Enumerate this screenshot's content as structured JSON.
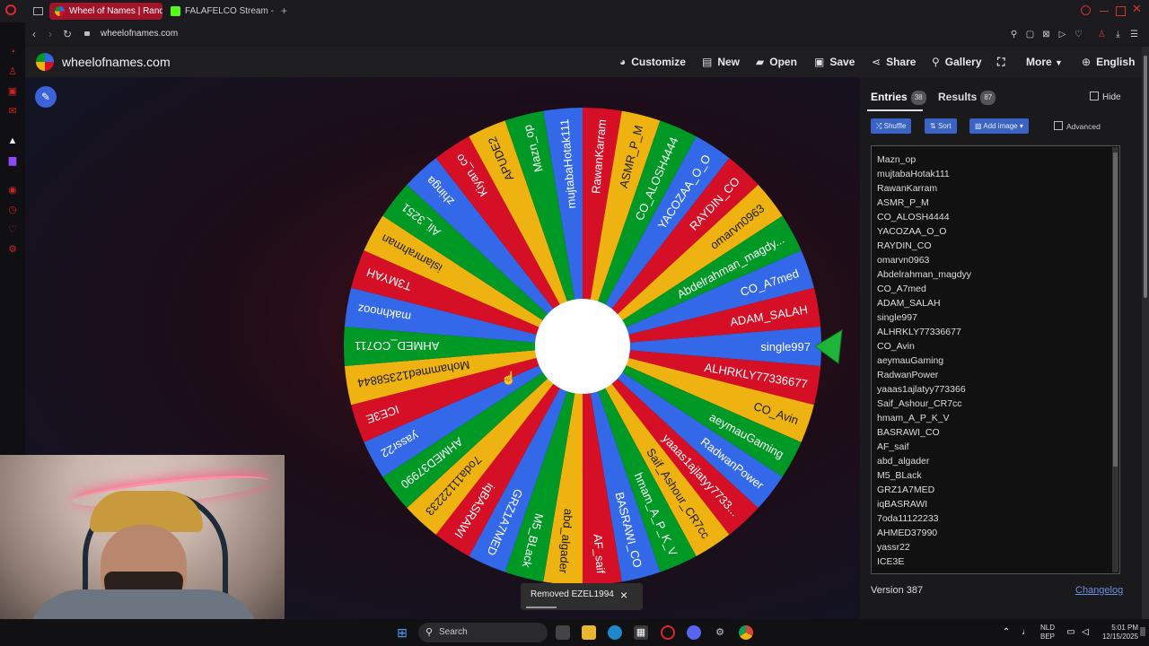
{
  "browser": {
    "tabs": [
      {
        "title": "Wheel of Names | Randon",
        "active": true,
        "color": "#c42b3a"
      },
      {
        "title": "FALAFELCO Stream - Wa",
        "active": false,
        "color": "#53fc18"
      }
    ],
    "new_tab_label": "+",
    "url": "wheelofnames.com"
  },
  "header": {
    "site_name": "wheelofnames.com",
    "menu": [
      {
        "label": "Customize",
        "icon": "palette-icon"
      },
      {
        "label": "New",
        "icon": "file-icon"
      },
      {
        "label": "Open",
        "icon": "folder-icon"
      },
      {
        "label": "Save",
        "icon": "save-icon"
      },
      {
        "label": "Share",
        "icon": "share-icon"
      },
      {
        "label": "Gallery",
        "icon": "search-icon"
      },
      {
        "label": "",
        "icon": "fullscreen-icon"
      },
      {
        "label": "More",
        "icon": "chevron-down-icon"
      },
      {
        "label": "English",
        "icon": "globe-icon"
      }
    ]
  },
  "panel": {
    "entries_tab": "Entries",
    "entries_count": "38",
    "results_tab": "Results",
    "results_count": "87",
    "hide_label": "Hide",
    "shuffle_label": "Shuffle",
    "sort_label": "Sort",
    "add_image_label": "Add image",
    "advanced_label": "Advanced",
    "version": "Version 387",
    "changelog": "Changelog"
  },
  "entries_visible": [
    "Mazn_op",
    "mujtabaHotak111",
    "RawanKarram",
    "ASMR_P_M",
    "CO_ALOSH4444",
    "YACOZAA_O_O",
    "RAYDIN_CO",
    "omarvn0963",
    "Abdelrahman_magdyy",
    "CO_A7med",
    "ADAM_SALAH",
    "single997",
    "ALHRKLY77336677",
    "CO_Avin",
    "aeymauGaming",
    "RadwanPower",
    "yaaas1ajlatyy773366",
    "Saif_Ashour_CR7cc",
    "hmam_A_P_K_V",
    "BASRAWI_CO",
    "AF_saif",
    "abd_algader",
    "M5_BLack",
    "GRZ1A7MED",
    "iqBASRAWI",
    "7oda11122233",
    "AHMED37990",
    "yassr22",
    "ICE3E"
  ],
  "wheel": {
    "colors": [
      "#3369e8",
      "#d50f25",
      "#eeb211",
      "#009925"
    ],
    "segments": [
      "single997",
      "ALHRKLY77336677",
      "CO_Avin",
      "aeymauGaming",
      "RadwanPower",
      "yaaas1ajlatyy7733...",
      "Saif_Ashour_CR7cc",
      "hmam_A_P_K_V",
      "BASRAWI_CO",
      "AF_saif",
      "abd_algader",
      "M5_BLack",
      "GRZ1A7MED",
      "iqBASRAWI",
      "7oda11122233",
      "AHMED37990",
      "yassr22",
      "ICE3E",
      "Mohammed12358844",
      "AHMED_CO711",
      "makhnooz",
      "T3MYAH",
      "islamrahman",
      "Ali_3251",
      "zhinga",
      "Kiyan_co",
      "APUDE2",
      "Mazn_op",
      "mujtabaHotak111",
      "RawanKarram",
      "ASMR_P_M",
      "CO_ALOSH4444",
      "YACOZAA_O_O",
      "RAYDIN_CO",
      "omarvn0963",
      "Abdelrahman_magdy...",
      "CO_A7med",
      "ADAM_SALAH"
    ]
  },
  "toast": {
    "text": "Removed EZEL1994",
    "close": "×"
  },
  "taskbar": {
    "search": "Search",
    "lang_top": "NLD",
    "lang_bottom": "BEP",
    "time": "5:01 PM",
    "date": "12/15/2025"
  }
}
